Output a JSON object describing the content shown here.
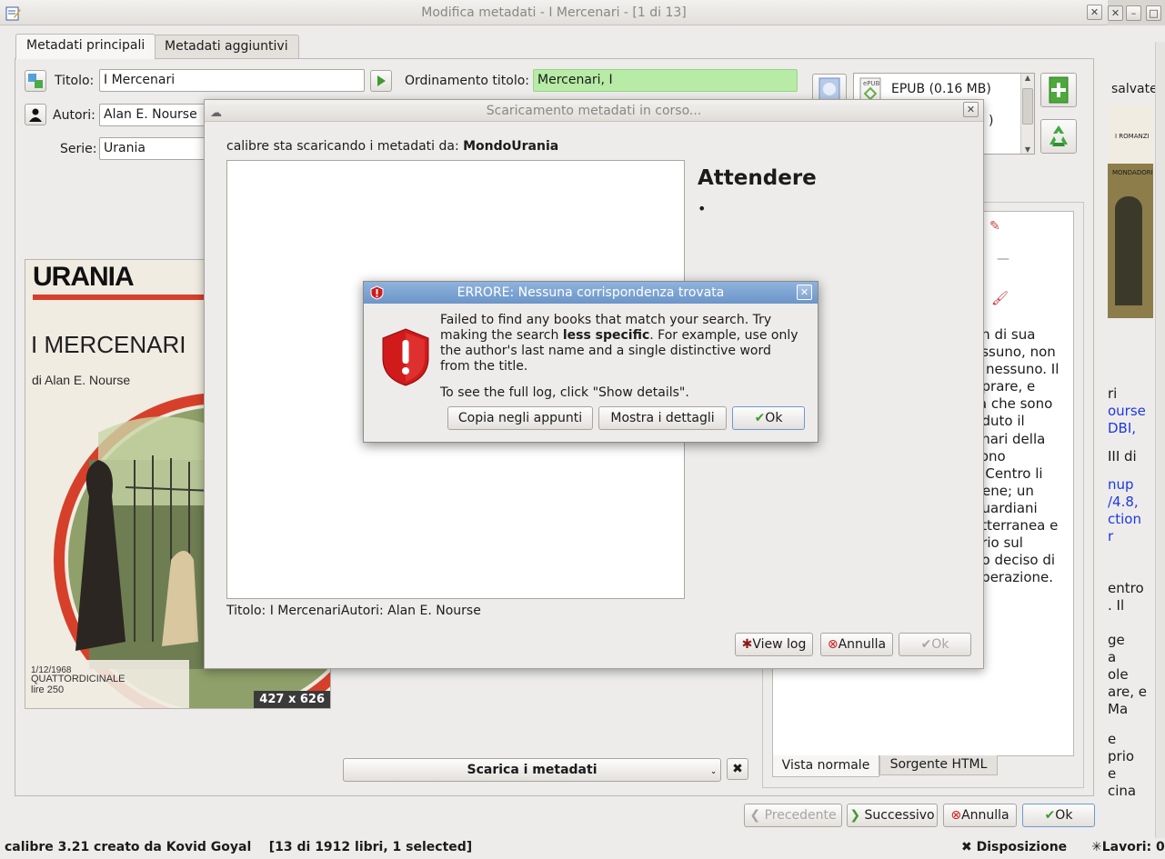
{
  "window": {
    "title": "Modifica metadati - I Mercenari -  [1 di 13]"
  },
  "tabs": [
    "Metadati principali",
    "Metadati aggiuntivi"
  ],
  "form": {
    "title_label": "Titolo:",
    "title_value": "I Mercenari",
    "title_sort_label": "Ordinamento titolo:",
    "title_sort_value": "Mercenari, I",
    "authors_label": "Autori:",
    "authors_value": "Alan E. Nourse",
    "series_label": "Serie:",
    "series_value": "Urania"
  },
  "formats": {
    "item": "EPUB (0.16 MB)",
    "partial": ")"
  },
  "cover": {
    "brand": "URANIA",
    "title": "I MERCENARI",
    "author_line": "di Alan E. Nourse",
    "date_line": "1/12/1968",
    "freq_line": "QUATTORDICINALE",
    "price_line": "lire 250",
    "size_badge": "427 x 626"
  },
  "download_button": "Scarica i metadati",
  "comments_tabs": [
    "Vista normale",
    "Sorgente HTML"
  ],
  "comments_lines": [
    "on di sua",
    "essuno, non",
    "a nessuno. Il",
    "nprare, e",
    "ta che sono",
    "nduto il",
    "enari della",
    "sono",
    "Il Centro li",
    "tiene; un",
    "guardiani",
    "otterranea e",
    "ario sul",
    "no deciso di",
    "operazione."
  ],
  "bottom_buttons": {
    "prev": "Precedente",
    "next": "Successivo",
    "cancel": "Annulla",
    "ok": "Ok"
  },
  "statusbar": {
    "left": "calibre 3.21 creato da Kovid Goyal    [13 di 1912 libri, 1 selected]",
    "layout": "Disposizione",
    "jobs": "Lavori: 0"
  },
  "background_right": {
    "saved": "salvate",
    "cover_small_1": "I ROMANZI",
    "cover_small_2": "MONDADORI",
    "lines": [
      {
        "t": "ri",
        "link": false
      },
      {
        "t": "ourse",
        "link": true
      },
      {
        "t": "DBI,",
        "link": true
      },
      {
        "t": "III di",
        "link": false
      },
      {
        "t": "nup",
        "link": true
      },
      {
        "t": "/4.8,",
        "link": true
      },
      {
        "t": "ction",
        "link": true
      },
      {
        "t": "r",
        "link": true
      },
      {
        "t": "entro",
        "link": false
      },
      {
        "t": ". Il",
        "link": false
      },
      {
        "t": "ge",
        "link": false
      },
      {
        "t": "a",
        "link": false
      },
      {
        "t": "ole",
        "link": false
      },
      {
        "t": "are, e",
        "link": false
      },
      {
        "t": "Ma",
        "link": false
      },
      {
        "t": "e",
        "link": false
      },
      {
        "t": "prio",
        "link": false
      },
      {
        "t": "e",
        "link": false
      },
      {
        "t": "cina",
        "link": false
      }
    ]
  },
  "download_dialog": {
    "title": "Scaricamento metadati in corso...",
    "source_prefix": "calibre sta scaricando i metadati da: ",
    "source_name": "MondoUrania",
    "wait_heading": "Attendere",
    "bullet": "•",
    "summary": "Titolo: I MercenariAutori: Alan E. Nourse",
    "view_log": "View log",
    "cancel": "Annulla",
    "ok": "Ok"
  },
  "error_dialog": {
    "title": "ERRORE: Nessuna corrispondenza trovata",
    "msg_part1": "Failed to find any books that match your search. Try making the search ",
    "msg_bold": "less specific",
    "msg_part2": ". For example, use only the author's last name and a single distinctive word from the title.",
    "msg2": "To see the full log, click \"Show details\".",
    "copy_button": "Copia negli appunti",
    "details_button": "Mostra i dettagli",
    "ok_button": "Ok"
  }
}
